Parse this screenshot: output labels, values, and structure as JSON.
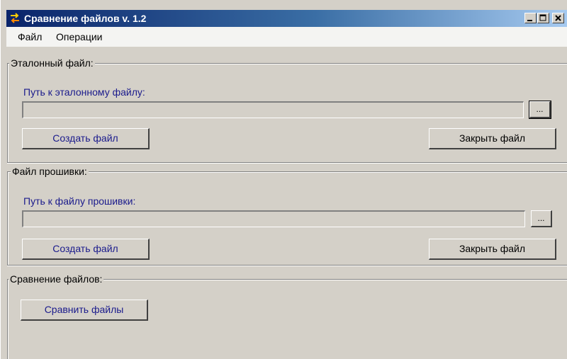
{
  "window": {
    "title": "Сравнение файлов v. 1.2",
    "controls": {
      "minimize": "_",
      "maximize": "□",
      "close": "X"
    }
  },
  "menu": {
    "file": "Файл",
    "operations": "Операции"
  },
  "reference_group": {
    "caption": "Эталонный файл:",
    "path_label": "Путь к эталонному файлу:",
    "path_value": "",
    "browse_label": "...",
    "create_label": "Создать файл",
    "close_label": "Закрыть файл"
  },
  "firmware_group": {
    "caption": "Файл прошивки:",
    "path_label": "Путь к файлу прошивки:",
    "path_value": "",
    "browse_label": "...",
    "create_label": "Создать файл",
    "close_label": "Закрыть файл"
  },
  "compare_group": {
    "caption": "Сравнение файлов:",
    "compare_label": "Сравнить файлы"
  },
  "colors": {
    "title_gradient_start": "#0a246a",
    "title_gradient_end": "#a6caf0",
    "face": "#d4d0c8",
    "label_blue": "#1a1a8c"
  }
}
